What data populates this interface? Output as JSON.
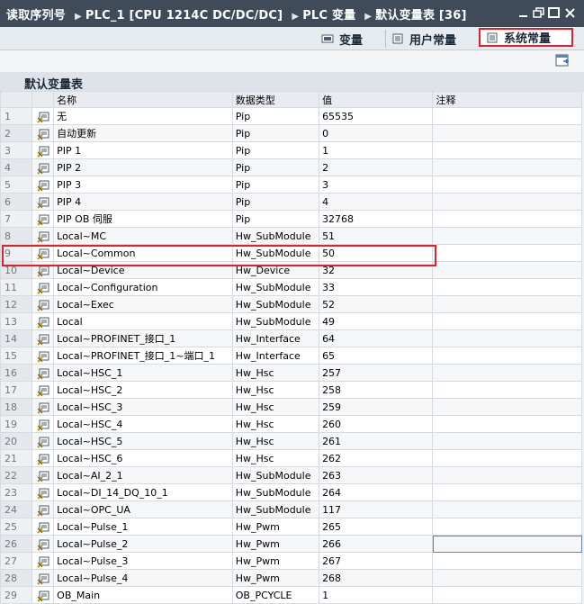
{
  "breadcrumb": [
    "读取序列号",
    "PLC_1 [CPU 1214C DC/DC/DC]",
    "PLC 变量",
    "默认变量表 [36]"
  ],
  "tabs": {
    "variables": "变量",
    "user_constants": "用户常量",
    "system_constants": "系统常量"
  },
  "panel_title": "默认变量表",
  "columns": {
    "name": "名称",
    "type": "数据类型",
    "value": "值",
    "comment": "注释"
  },
  "rows": [
    {
      "n": "1",
      "name": "无",
      "type": "Pip",
      "value": "65535"
    },
    {
      "n": "2",
      "name": "自动更新",
      "type": "Pip",
      "value": "0"
    },
    {
      "n": "3",
      "name": "PIP 1",
      "type": "Pip",
      "value": "1"
    },
    {
      "n": "4",
      "name": "PIP 2",
      "type": "Pip",
      "value": "2"
    },
    {
      "n": "5",
      "name": "PIP 3",
      "type": "Pip",
      "value": "3"
    },
    {
      "n": "6",
      "name": "PIP 4",
      "type": "Pip",
      "value": "4"
    },
    {
      "n": "7",
      "name": "PIP OB 伺服",
      "type": "Pip",
      "value": "32768"
    },
    {
      "n": "8",
      "name": "Local~MC",
      "type": "Hw_SubModule",
      "value": "51"
    },
    {
      "n": "9",
      "name": "Local~Common",
      "type": "Hw_SubModule",
      "value": "50"
    },
    {
      "n": "10",
      "name": "Local~Device",
      "type": "Hw_Device",
      "value": "32"
    },
    {
      "n": "11",
      "name": "Local~Configuration",
      "type": "Hw_SubModule",
      "value": "33"
    },
    {
      "n": "12",
      "name": "Local~Exec",
      "type": "Hw_SubModule",
      "value": "52"
    },
    {
      "n": "13",
      "name": "Local",
      "type": "Hw_SubModule",
      "value": "49"
    },
    {
      "n": "14",
      "name": "Local~PROFINET_接口_1",
      "type": "Hw_Interface",
      "value": "64"
    },
    {
      "n": "15",
      "name": "Local~PROFINET_接口_1~端口_1",
      "type": "Hw_Interface",
      "value": "65"
    },
    {
      "n": "16",
      "name": "Local~HSC_1",
      "type": "Hw_Hsc",
      "value": "257"
    },
    {
      "n": "17",
      "name": "Local~HSC_2",
      "type": "Hw_Hsc",
      "value": "258"
    },
    {
      "n": "18",
      "name": "Local~HSC_3",
      "type": "Hw_Hsc",
      "value": "259"
    },
    {
      "n": "19",
      "name": "Local~HSC_4",
      "type": "Hw_Hsc",
      "value": "260"
    },
    {
      "n": "20",
      "name": "Local~HSC_5",
      "type": "Hw_Hsc",
      "value": "261"
    },
    {
      "n": "21",
      "name": "Local~HSC_6",
      "type": "Hw_Hsc",
      "value": "262"
    },
    {
      "n": "22",
      "name": "Local~AI_2_1",
      "type": "Hw_SubModule",
      "value": "263"
    },
    {
      "n": "23",
      "name": "Local~DI_14_DQ_10_1",
      "type": "Hw_SubModule",
      "value": "264"
    },
    {
      "n": "24",
      "name": "Local~OPC_UA",
      "type": "Hw_SubModule",
      "value": "117"
    },
    {
      "n": "25",
      "name": "Local~Pulse_1",
      "type": "Hw_Pwm",
      "value": "265"
    },
    {
      "n": "26",
      "name": "Local~Pulse_2",
      "type": "Hw_Pwm",
      "value": "266"
    },
    {
      "n": "27",
      "name": "Local~Pulse_3",
      "type": "Hw_Pwm",
      "value": "267"
    },
    {
      "n": "28",
      "name": "Local~Pulse_4",
      "type": "Hw_Pwm",
      "value": "268"
    },
    {
      "n": "29",
      "name": "OB_Main",
      "type": "OB_PCYCLE",
      "value": "1"
    }
  ],
  "colors": {
    "titlebar": "#3f4b58",
    "highlight": "#e0212b"
  }
}
